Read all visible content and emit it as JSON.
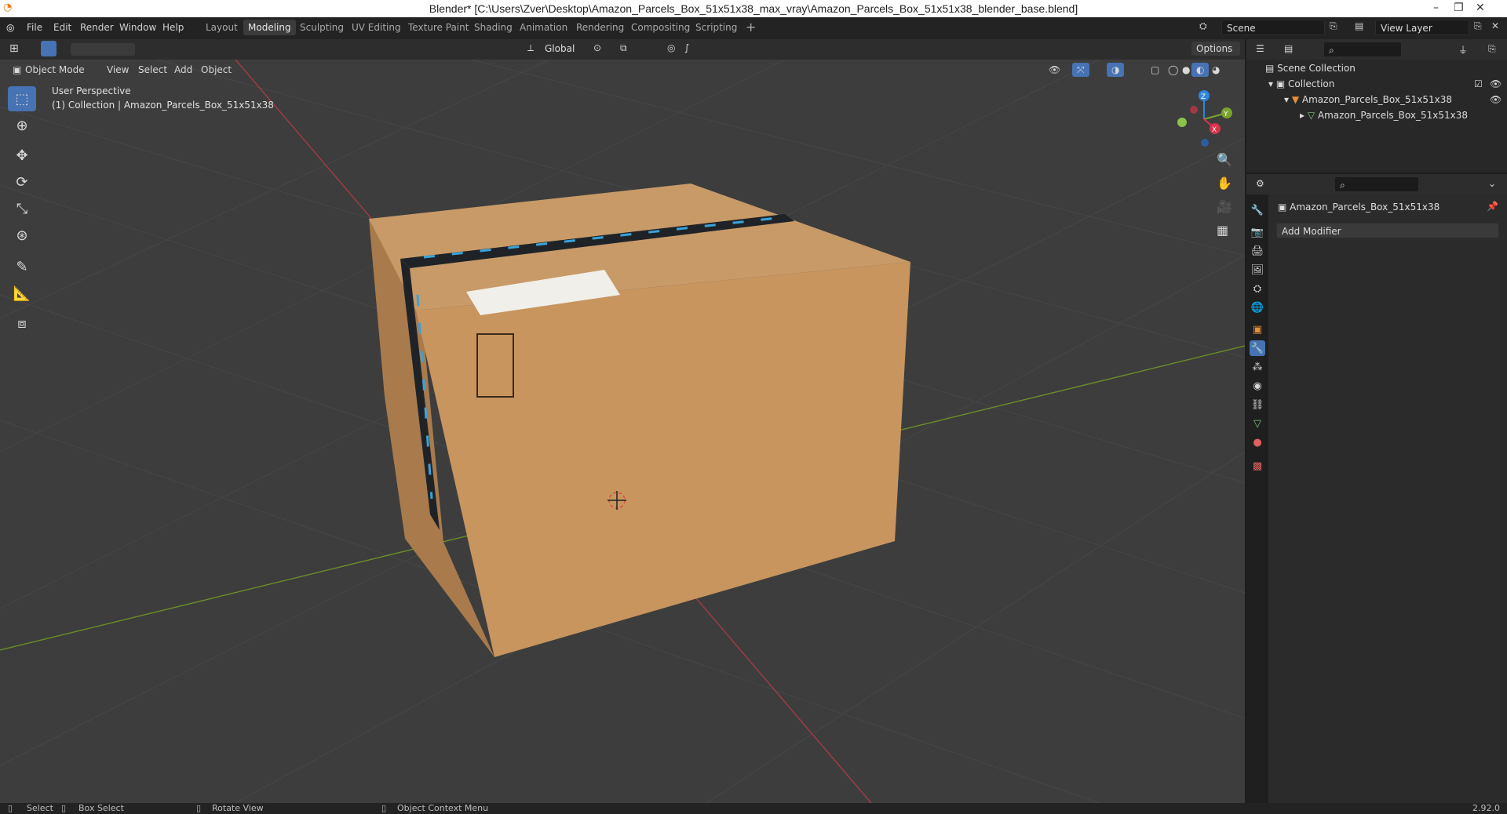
{
  "title": "Blender* [C:\\Users\\Zver\\Desktop\\Amazon_Parcels_Box_51x51x38_max_vray\\Amazon_Parcels_Box_51x51x38_blender_base.blend]",
  "menus": [
    "File",
    "Edit",
    "Render",
    "Window",
    "Help"
  ],
  "workspaces": [
    "Layout",
    "Modeling",
    "Sculpting",
    "UV Editing",
    "Texture Paint",
    "Shading",
    "Animation",
    "Rendering",
    "Compositing",
    "Scripting"
  ],
  "active_workspace": "Modeling",
  "scene": "Scene",
  "view_layer": "View Layer",
  "header": {
    "orientation": "Global",
    "options": "Options"
  },
  "viewport_menu": {
    "mode": "Object Mode",
    "items": [
      "View",
      "Select",
      "Add",
      "Object"
    ]
  },
  "viewport_info": {
    "perspective": "User Perspective",
    "collection_line": "(1) Collection | Amazon_Parcels_Box_51x51x38"
  },
  "gizmo": {
    "z": "Z",
    "y": "Y",
    "x": "X"
  },
  "outliner": {
    "scene_collection": "Scene Collection",
    "collection": "Collection",
    "object": "Amazon_Parcels_Box_51x51x38",
    "mesh": "Amazon_Parcels_Box_51x51x38"
  },
  "properties": {
    "object_name": "Amazon_Parcels_Box_51x51x38",
    "add_modifier": "Add Modifier"
  },
  "status": {
    "select": "Select",
    "box_select": "Box Select",
    "rotate_view": "Rotate View",
    "context_menu": "Object Context Menu",
    "version": "2.92.0"
  },
  "colors": {
    "accent": "#4772b3",
    "box": "#c8955f",
    "tape": "#1f2328",
    "tape_logo": "#3aa3d9"
  }
}
